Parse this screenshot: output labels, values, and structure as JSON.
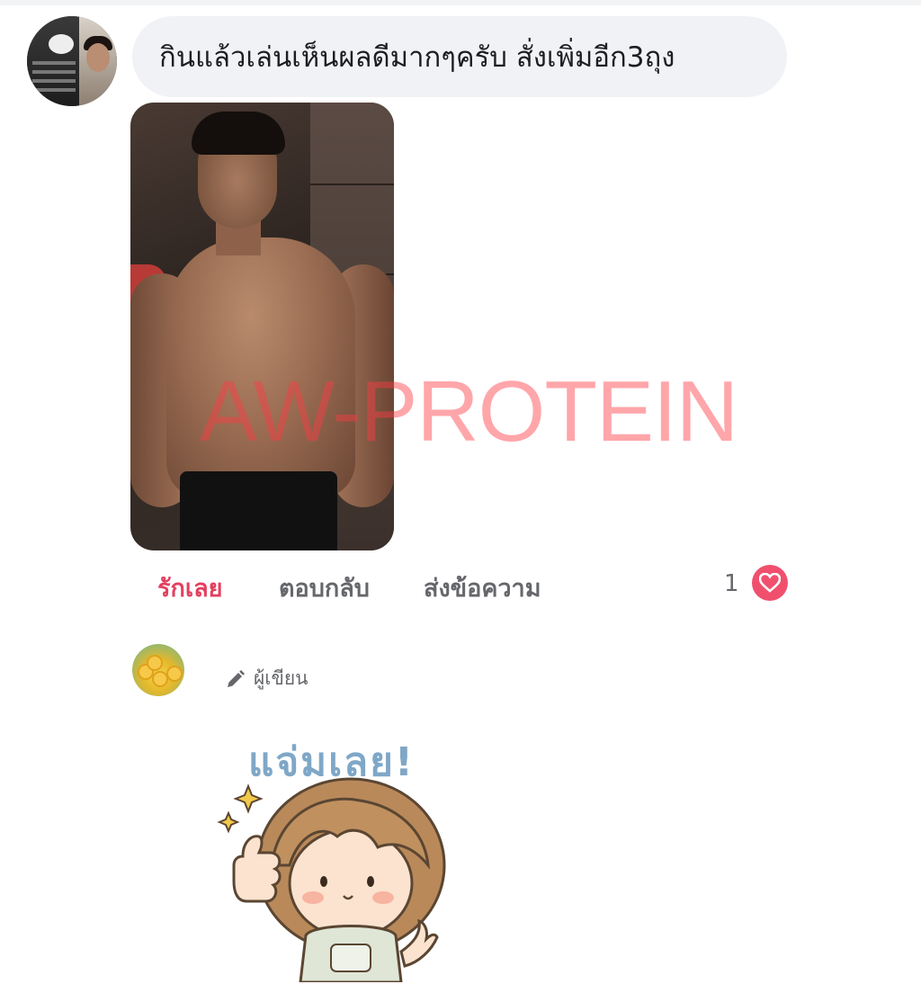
{
  "comment1": {
    "text": "กินแล้วเล่นเห็นผลดีมากๆครับ สั่งเพิ่มอีก3ถุง",
    "watermark": "AW-PROTEIN",
    "actions": {
      "love": "รักเลย",
      "reply": "ตอบกลับ",
      "message": "ส่งข้อความ"
    },
    "reaction_count": "1",
    "accent_color": "#e3405f",
    "reaction_icon": "heart-icon"
  },
  "comment2": {
    "author_label": "ผู้เขียน",
    "author_icon": "pencil-icon",
    "sticker_text": "แจ่มเลย!"
  },
  "colors": {
    "bubble": "#f0f2f5",
    "muted": "#65676b",
    "watermark": "#ff3b45"
  }
}
